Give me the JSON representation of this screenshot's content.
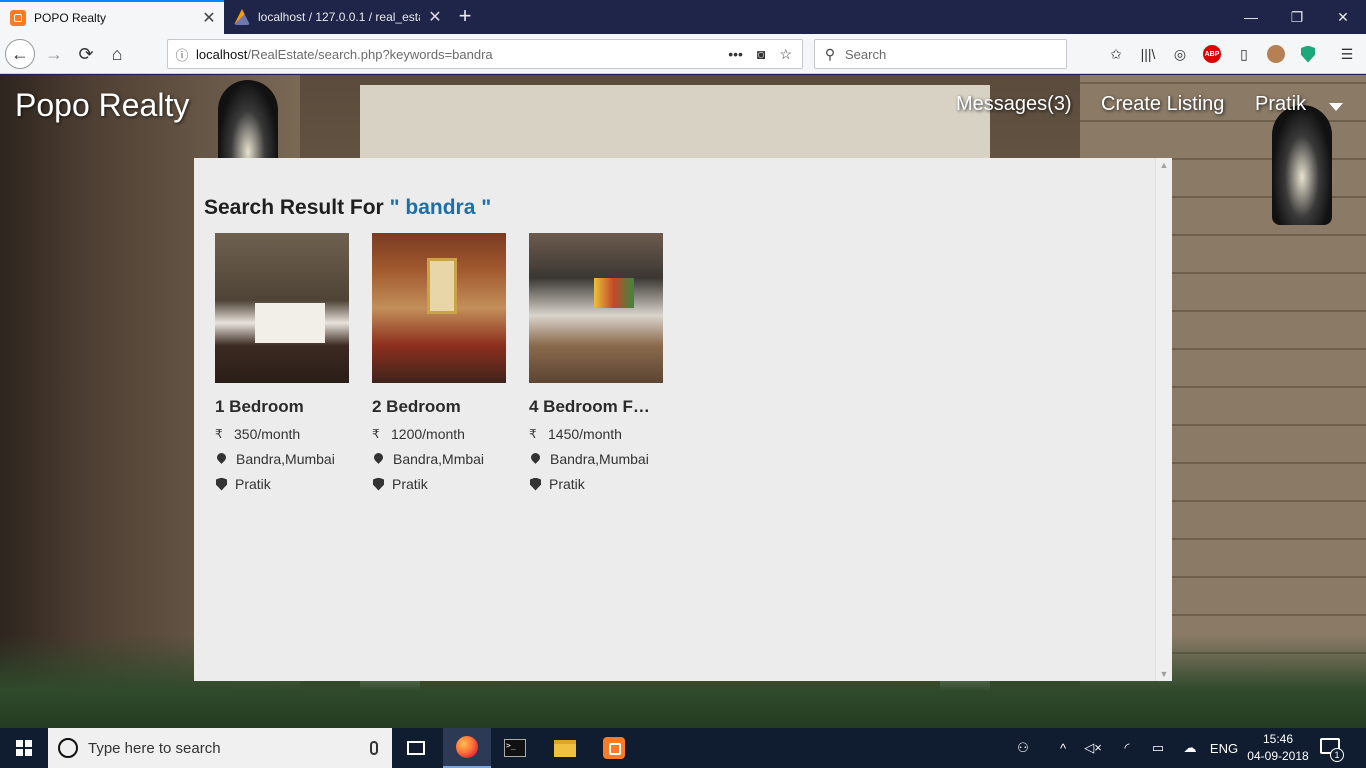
{
  "browser": {
    "tabs": [
      {
        "title": "POPO Realty",
        "active": true,
        "favicon": "xampp-icon"
      },
      {
        "title": "localhost / 127.0.0.1 / real_estat",
        "active": false,
        "favicon": "phpmyadmin-icon"
      }
    ],
    "url": {
      "host": "localhost",
      "path": "/RealEstate/search.php?keywords=bandra"
    },
    "search_placeholder": "Search",
    "window_controls": {
      "minimize": "—",
      "restore": "❐",
      "close": "✕"
    }
  },
  "site": {
    "brand": "Popo Realty",
    "nav": {
      "messages": "Messages(3)",
      "create_listing": "Create Listing",
      "user": "Pratik"
    }
  },
  "search": {
    "title_prefix": "Search Result For",
    "keyword_display": "\" bandra \"",
    "keyword": "bandra"
  },
  "listings": [
    {
      "name": "1 Bedroom",
      "price": "350/month",
      "location": "Bandra,Mumbai",
      "owner": "Pratik",
      "currency": "₹"
    },
    {
      "name": "2 Bedroom",
      "price": "1200/month",
      "location": "Bandra,Mmbai",
      "owner": "Pratik",
      "currency": "₹"
    },
    {
      "name": "4 Bedroom F…",
      "price": "1450/month",
      "location": "Bandra,Mumbai",
      "owner": "Pratik",
      "currency": "₹"
    }
  ],
  "taskbar": {
    "search_placeholder": "Type here to search",
    "language": "ENG",
    "time": "15:46",
    "date": "04-09-2018",
    "notification_count": "1"
  },
  "colors": {
    "accent_keyword": "#1d6fa8",
    "tab_accent": "#0a84ff",
    "taskbar_bg": "#101c30"
  }
}
